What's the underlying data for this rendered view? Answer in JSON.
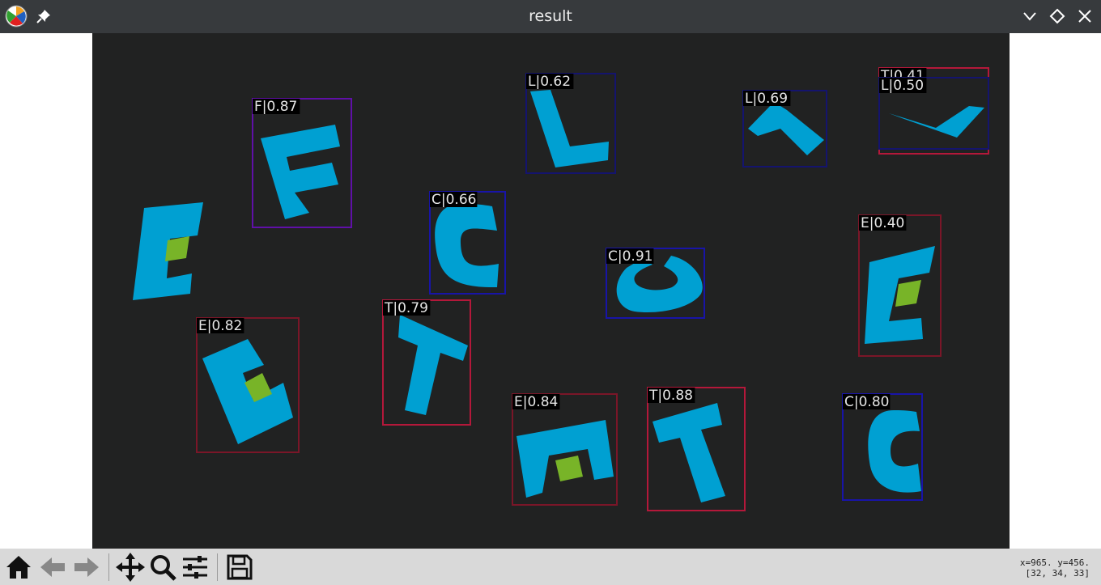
{
  "window": {
    "title": "result",
    "app_icon": "matplotlib-icon",
    "controls": [
      "pin-icon",
      "minimize-chevron-icon",
      "maximize-diamond-icon",
      "close-x-icon"
    ]
  },
  "colors": {
    "titlebar": "#373a3d",
    "canvas_background": "#212222",
    "letter_fill": "#00a0d2",
    "marker_fill": "#78b428",
    "label_background": "#000000",
    "label_text": "#e6e6e6",
    "box_red": "#b4183a",
    "box_darkred": "#7a1628",
    "box_blue": "#1814a8",
    "box_navy": "#14146e",
    "box_purple": "#6010a8"
  },
  "detections": [
    {
      "label": "F|0.87",
      "color": "box_purple"
    },
    {
      "label": "L|0.62",
      "color": "box_navy"
    },
    {
      "label": "L|0.69",
      "color": "box_navy"
    },
    {
      "label": "T|0.41",
      "color": "box_red"
    },
    {
      "label": "L|0.50",
      "color": "box_navy"
    },
    {
      "label": "C|0.66",
      "color": "box_blue"
    },
    {
      "label": "C|0.91",
      "color": "box_blue"
    },
    {
      "label": "E|0.40",
      "color": "box_darkred"
    },
    {
      "label": "E|0.82",
      "color": "box_darkred"
    },
    {
      "label": "T|0.79",
      "color": "box_red"
    },
    {
      "label": "E|0.84",
      "color": "box_darkred"
    },
    {
      "label": "T|0.88",
      "color": "box_red"
    },
    {
      "label": "C|0.80",
      "color": "box_blue"
    }
  ],
  "toolbar": {
    "buttons": [
      "home-icon",
      "back-arrow-icon",
      "forward-arrow-icon",
      "pan-move-icon",
      "zoom-magnifier-icon",
      "configure-subplots-icon",
      "save-floppy-icon"
    ]
  },
  "status": {
    "cursor_position": "x=965. y=456.",
    "pixel_value": "[32, 34, 33]"
  }
}
